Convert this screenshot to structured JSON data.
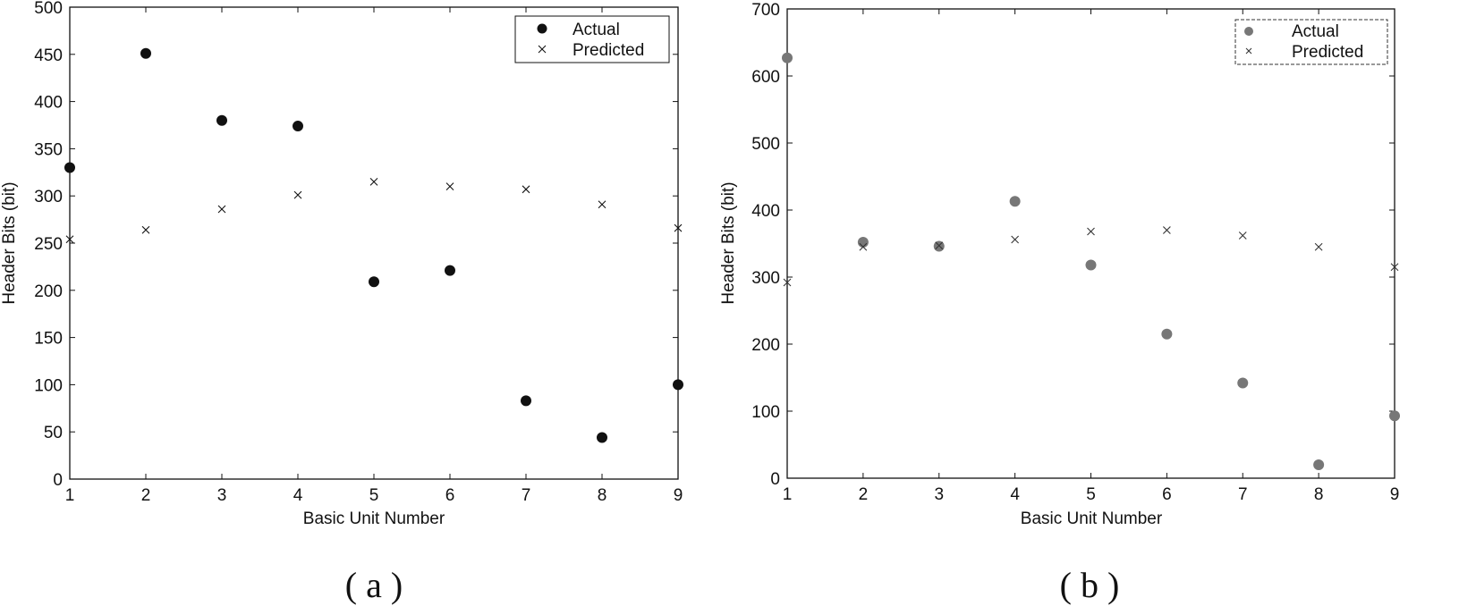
{
  "chart_data": [
    {
      "id": "a",
      "type": "scatter",
      "caption": "( a )",
      "title": "",
      "xlabel": "Basic Unit Number",
      "ylabel": "Header Bits (bit)",
      "xlim": [
        1,
        9
      ],
      "ylim": [
        0,
        500
      ],
      "xticks": [
        1,
        2,
        3,
        4,
        5,
        6,
        7,
        8,
        9
      ],
      "yticks": [
        0,
        50,
        100,
        150,
        200,
        250,
        300,
        350,
        400,
        450,
        500
      ],
      "grid": false,
      "legend_position": "top-right",
      "series": [
        {
          "name": "Actual",
          "marker": "filled-circle",
          "x": [
            1,
            2,
            3,
            4,
            5,
            6,
            7,
            8,
            9
          ],
          "y": [
            330,
            451,
            380,
            374,
            209,
            221,
            83,
            44,
            100
          ]
        },
        {
          "name": "Predicted",
          "marker": "x",
          "x": [
            1,
            2,
            3,
            4,
            5,
            6,
            7,
            8,
            9
          ],
          "y": [
            254,
            264,
            286,
            301,
            315,
            310,
            307,
            291,
            266
          ]
        }
      ]
    },
    {
      "id": "b",
      "type": "scatter",
      "caption": "( b )",
      "title": "",
      "xlabel": "Basic Unit Number",
      "ylabel": "Header Bits (bit)",
      "xlim": [
        1,
        9
      ],
      "ylim": [
        0,
        700
      ],
      "xticks": [
        1,
        2,
        3,
        4,
        5,
        6,
        7,
        8,
        9
      ],
      "yticks": [
        0,
        100,
        200,
        300,
        400,
        500,
        600,
        700
      ],
      "grid": false,
      "legend_position": "top-right",
      "series": [
        {
          "name": "Actual",
          "marker": "filled-circle",
          "x": [
            1,
            2,
            3,
            4,
            5,
            6,
            7,
            8,
            9
          ],
          "y": [
            627,
            352,
            346,
            413,
            318,
            215,
            142,
            20,
            93
          ]
        },
        {
          "name": "Predicted",
          "marker": "x",
          "x": [
            1,
            2,
            3,
            4,
            5,
            6,
            7,
            8,
            9
          ],
          "y": [
            292,
            345,
            347,
            356,
            368,
            370,
            362,
            345,
            315
          ]
        }
      ]
    }
  ]
}
